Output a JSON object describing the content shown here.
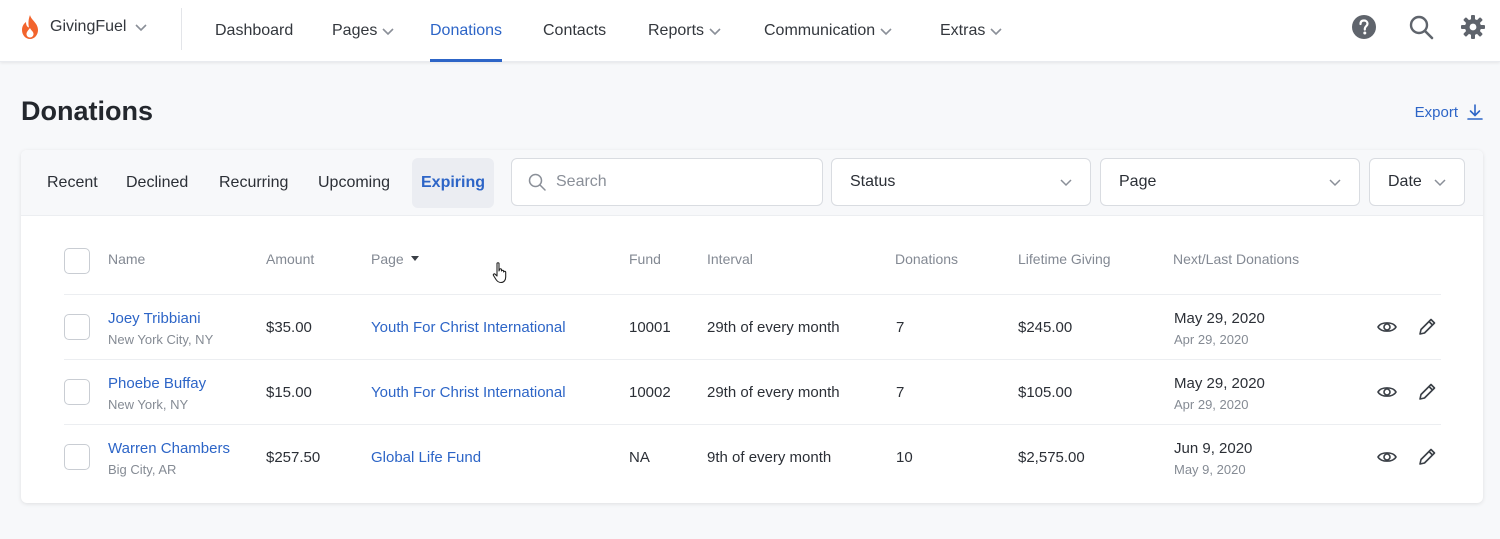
{
  "brand": {
    "name": "GivingFuel",
    "icon": "flame-logo-icon",
    "accent": "#f2642d"
  },
  "nav": {
    "items": [
      {
        "label": "Dashboard",
        "dropdown": false
      },
      {
        "label": "Pages",
        "dropdown": true
      },
      {
        "label": "Donations",
        "dropdown": false,
        "active": true
      },
      {
        "label": "Contacts",
        "dropdown": false
      },
      {
        "label": "Reports",
        "dropdown": true
      },
      {
        "label": "Communication",
        "dropdown": true
      },
      {
        "label": "Extras",
        "dropdown": true
      }
    ],
    "icons": [
      "help-icon",
      "search-icon",
      "gear-icon"
    ]
  },
  "page": {
    "title": "Donations",
    "export_label": "Export"
  },
  "tabs": [
    "Recent",
    "Declined",
    "Recurring",
    "Upcoming",
    "Expiring"
  ],
  "active_tab": "Expiring",
  "filters": {
    "search_placeholder": "Search",
    "status": "Status",
    "page": "Page",
    "date": "Date"
  },
  "table": {
    "columns": [
      "Name",
      "Amount",
      "Page",
      "Fund",
      "Interval",
      "Donations",
      "Lifetime Giving",
      "Next/Last Donations"
    ],
    "sorted_column": "Page",
    "rows": [
      {
        "name": "Joey Tribbiani",
        "location": "New York City, NY",
        "amount": "$35.00",
        "page": "Youth For Christ International",
        "fund": "10001",
        "interval": "29th of every month",
        "donations": "7",
        "lifetime": "$245.00",
        "next": "May 29, 2020",
        "last": "Apr 29, 2020"
      },
      {
        "name": "Phoebe Buffay",
        "location": "New York, NY",
        "amount": "$15.00",
        "page": "Youth For Christ International",
        "fund": "10002",
        "interval": "29th of every month",
        "donations": "7",
        "lifetime": "$105.00",
        "next": "May 29, 2020",
        "last": "Apr 29, 2020"
      },
      {
        "name": "Warren Chambers",
        "location": "Big City, AR",
        "amount": "$257.50",
        "page": "Global Life Fund",
        "fund": "NA",
        "interval": "9th of every month",
        "donations": "10",
        "lifetime": "$2,575.00",
        "next": "Jun 9, 2020",
        "last": "May 9, 2020"
      }
    ]
  },
  "colors": {
    "link": "#2d65c7",
    "text": "#2b2f36",
    "muted": "#838993"
  }
}
